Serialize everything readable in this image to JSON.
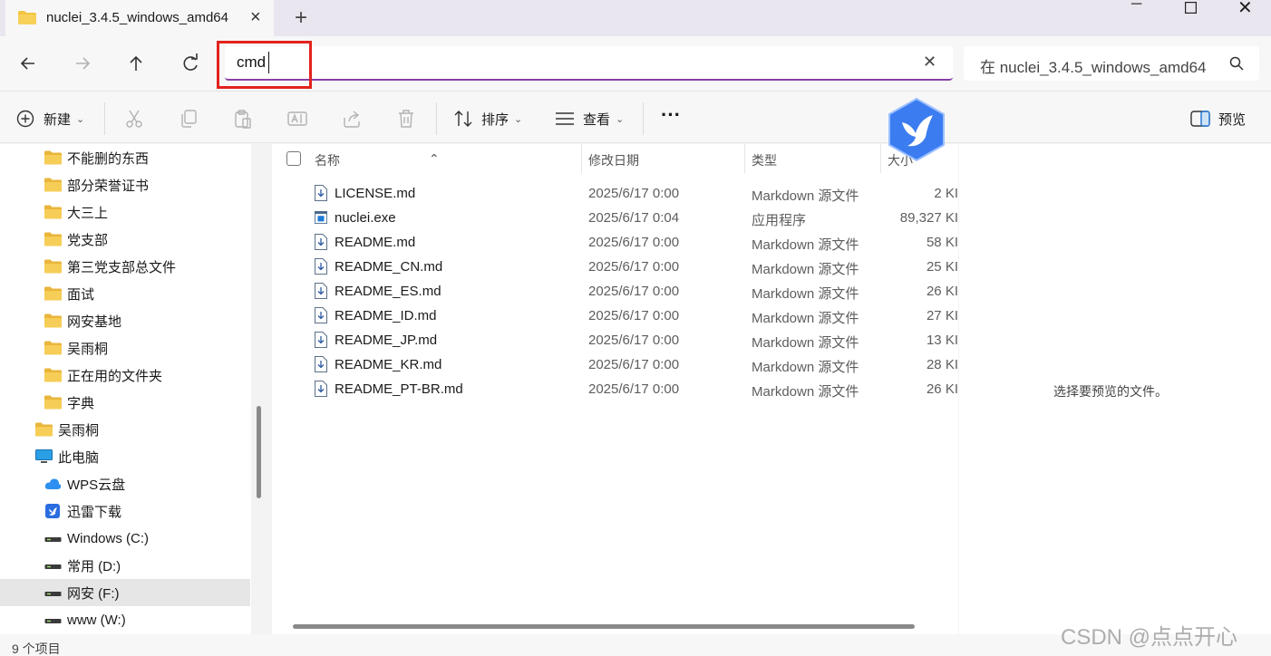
{
  "tab": {
    "title": "nuclei_3.4.5_windows_amd64"
  },
  "address": {
    "value": "cmd"
  },
  "search": {
    "placeholder": "在 nuclei_3.4.5_windows_amd64"
  },
  "toolbar": {
    "new_label": "新建",
    "sort_label": "排序",
    "view_label": "查看",
    "more_label": "···",
    "preview_label": "预览"
  },
  "sidebar": {
    "items": [
      {
        "label": "不能删的东西",
        "icon": "folder-icon"
      },
      {
        "label": "部分荣誉证书",
        "icon": "folder-icon"
      },
      {
        "label": "大三上",
        "icon": "folder-icon"
      },
      {
        "label": "党支部",
        "icon": "folder-icon"
      },
      {
        "label": "第三党支部总文件",
        "icon": "folder-icon"
      },
      {
        "label": "面试",
        "icon": "folder-icon"
      },
      {
        "label": "网安基地",
        "icon": "folder-icon"
      },
      {
        "label": "吴雨桐",
        "icon": "folder-icon"
      },
      {
        "label": "正在用的文件夹",
        "icon": "folder-icon"
      },
      {
        "label": "字典",
        "icon": "folder-icon"
      },
      {
        "label": "吴雨桐",
        "icon": "folder-icon"
      },
      {
        "label": "此电脑",
        "icon": "computer-icon"
      },
      {
        "label": "WPS云盘",
        "icon": "cloud-icon"
      },
      {
        "label": "迅雷下载",
        "icon": "xunlei-icon"
      },
      {
        "label": "Windows (C:)",
        "icon": "drive-icon"
      },
      {
        "label": "常用 (D:)",
        "icon": "drive-icon"
      },
      {
        "label": "网安 (F:)",
        "icon": "drive-icon"
      },
      {
        "label": "www (W:)",
        "icon": "drive-icon"
      }
    ]
  },
  "columns": {
    "name": "名称",
    "date": "修改日期",
    "type": "类型",
    "size": "大小"
  },
  "files": [
    {
      "name": "LICENSE.md",
      "date": "2025/6/17 0:00",
      "type": "Markdown 源文件",
      "size": "2 KI",
      "icon": "markdown-file-icon"
    },
    {
      "name": "nuclei.exe",
      "date": "2025/6/17 0:04",
      "type": "应用程序",
      "size": "89,327 KI",
      "icon": "exe-file-icon"
    },
    {
      "name": "README.md",
      "date": "2025/6/17 0:00",
      "type": "Markdown 源文件",
      "size": "58 KI",
      "icon": "markdown-file-icon"
    },
    {
      "name": "README_CN.md",
      "date": "2025/6/17 0:00",
      "type": "Markdown 源文件",
      "size": "25 KI",
      "icon": "markdown-file-icon"
    },
    {
      "name": "README_ES.md",
      "date": "2025/6/17 0:00",
      "type": "Markdown 源文件",
      "size": "26 KI",
      "icon": "markdown-file-icon"
    },
    {
      "name": "README_ID.md",
      "date": "2025/6/17 0:00",
      "type": "Markdown 源文件",
      "size": "27 KI",
      "icon": "markdown-file-icon"
    },
    {
      "name": "README_JP.md",
      "date": "2025/6/17 0:00",
      "type": "Markdown 源文件",
      "size": "13 KI",
      "icon": "markdown-file-icon"
    },
    {
      "name": "README_KR.md",
      "date": "2025/6/17 0:00",
      "type": "Markdown 源文件",
      "size": "28 KI",
      "icon": "markdown-file-icon"
    },
    {
      "name": "README_PT-BR.md",
      "date": "2025/6/17 0:00",
      "type": "Markdown 源文件",
      "size": "26 KI",
      "icon": "markdown-file-icon"
    }
  ],
  "preview": {
    "message": "选择要预览的文件。"
  },
  "status": {
    "count": "9 个项目"
  },
  "watermark": "CSDN @点点开心",
  "colors": {
    "accent": "#8a3fa8",
    "highlight": "#e3221e",
    "folder": "#f2c440"
  }
}
